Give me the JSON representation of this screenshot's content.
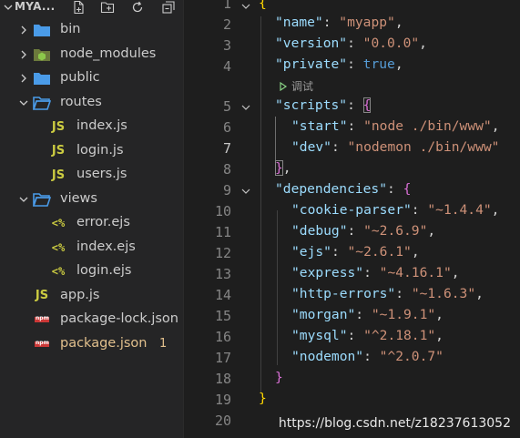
{
  "explorer": {
    "title": "MYA...",
    "actions": [
      "new-file-icon",
      "new-folder-icon",
      "refresh-icon",
      "collapse-all-icon"
    ]
  },
  "tree": [
    {
      "label": "bin",
      "type": "folder",
      "icon": "folder-blue-icon",
      "expanded": false,
      "depth": 1
    },
    {
      "label": "node_modules",
      "type": "folder",
      "icon": "folder-node-icon",
      "expanded": false,
      "depth": 1
    },
    {
      "label": "public",
      "type": "folder",
      "icon": "folder-blue-icon",
      "expanded": false,
      "depth": 1
    },
    {
      "label": "routes",
      "type": "folder",
      "icon": "folder-open-icon",
      "expanded": true,
      "depth": 1
    },
    {
      "label": "index.js",
      "type": "file",
      "icon": "js-icon",
      "depth": 2
    },
    {
      "label": "login.js",
      "type": "file",
      "icon": "js-icon",
      "depth": 2
    },
    {
      "label": "users.js",
      "type": "file",
      "icon": "js-icon",
      "depth": 2
    },
    {
      "label": "views",
      "type": "folder",
      "icon": "folder-open-icon",
      "expanded": true,
      "depth": 1
    },
    {
      "label": "error.ejs",
      "type": "file",
      "icon": "ejs-icon",
      "depth": 2
    },
    {
      "label": "index.ejs",
      "type": "file",
      "icon": "ejs-icon",
      "depth": 2
    },
    {
      "label": "login.ejs",
      "type": "file",
      "icon": "ejs-icon",
      "depth": 2
    },
    {
      "label": "app.js",
      "type": "file",
      "icon": "js-icon",
      "depth": 1
    },
    {
      "label": "package-lock.json",
      "type": "file",
      "icon": "npm-icon",
      "depth": 1
    },
    {
      "label": "package.json",
      "type": "file",
      "icon": "npm-icon",
      "depth": 1,
      "modified": true,
      "badge": "1"
    }
  ],
  "icon_text": {
    "js": "JS",
    "ejs": "<%",
    "npm": "npm"
  },
  "editor": {
    "lines": [
      "1",
      "2",
      "3",
      "4",
      "5",
      "6",
      "7",
      "8",
      "9",
      "10",
      "11",
      "12",
      "13",
      "14",
      "15",
      "16",
      "17",
      "18",
      "19",
      "20"
    ],
    "active_line": "7",
    "codelens": "调试",
    "tokens": {
      "l1_open": "{",
      "name_key": "\"name\"",
      "name_val": "\"myapp\"",
      "version_key": "\"version\"",
      "version_val": "\"0.0.0\"",
      "private_key": "\"private\"",
      "private_val": "true",
      "scripts_key": "\"scripts\"",
      "scripts_open": "{",
      "start_key": "\"start\"",
      "start_val": "\"node ./bin/www\"",
      "dev_key": "\"dev\"",
      "dev_val": "\"nodemon ./bin/www\"",
      "scripts_close": "}",
      "deps_key": "\"dependencies\"",
      "deps_open": "{",
      "d1_key": "\"cookie-parser\"",
      "d1_val": "\"~1.4.4\"",
      "d2_key": "\"debug\"",
      "d2_val": "\"~2.6.9\"",
      "d3_key": "\"ejs\"",
      "d3_val": "\"~2.6.1\"",
      "d4_key": "\"express\"",
      "d4_val": "\"~4.16.1\"",
      "d5_key": "\"http-errors\"",
      "d5_val": "\"~1.6.3\"",
      "d6_key": "\"morgan\"",
      "d6_val": "\"~1.9.1\"",
      "d7_key": "\"mysql\"",
      "d7_val": "\"^2.18.1\"",
      "d8_key": "\"nodemon\"",
      "d8_val": "\"^2.0.7\"",
      "deps_close": "}",
      "root_close": "}"
    }
  },
  "watermark": "https://blog.csdn.net/z18237613052",
  "colors": {
    "key": "#9cdcfe",
    "string": "#ce9178",
    "keyword": "#569cd6",
    "bracket1": "#ffd700",
    "bracket2": "#da70d6",
    "modified": "#e2c08d"
  }
}
